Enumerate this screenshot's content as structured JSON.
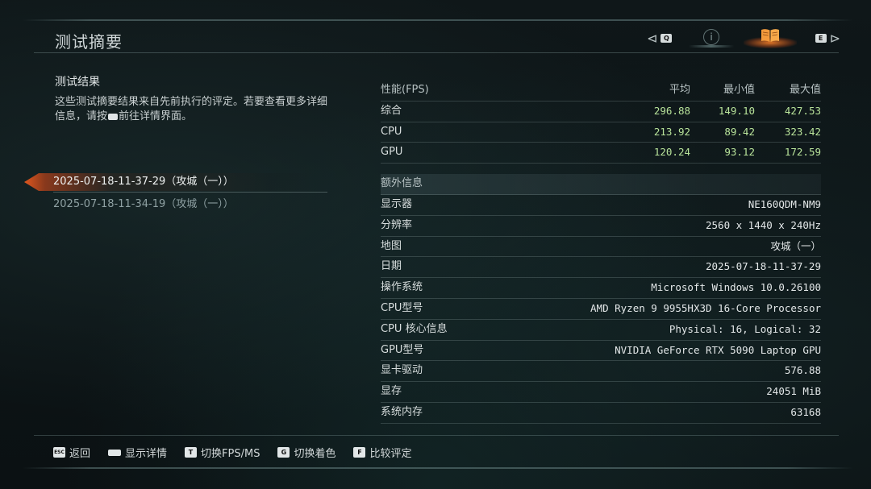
{
  "page": {
    "title": "测试摘要"
  },
  "nav": {
    "prev_key": "Q",
    "next_key": "E",
    "tabs": [
      {
        "name": "info",
        "active": false
      },
      {
        "name": "book",
        "active": true
      }
    ],
    "accent_color": "#ff7a2a"
  },
  "summary": {
    "section_title": "测试结果",
    "description_part1": "这些测试摘要结果来自先前执行的评定。若要查看更多详细信息，请按",
    "description_part2": "前往详情界面。"
  },
  "runs": [
    {
      "label": "2025-07-18-11-37-29（攻城（一））",
      "active": true
    },
    {
      "label": "2025-07-18-11-34-19（攻城（一））",
      "active": false
    }
  ],
  "performance": {
    "header": {
      "label": "性能(FPS)",
      "avg": "平均",
      "min": "最小值",
      "max": "最大值"
    },
    "rows": [
      {
        "label": "综合",
        "avg": "296.88",
        "min": "149.10",
        "max": "427.53"
      },
      {
        "label": "CPU",
        "avg": "213.92",
        "min": "89.42",
        "max": "323.42"
      },
      {
        "label": "GPU",
        "avg": "120.24",
        "min": "93.12",
        "max": "172.59"
      }
    ]
  },
  "extra": {
    "header": "额外信息",
    "rows": [
      {
        "label": "显示器",
        "value": "NE160QDM-NM9"
      },
      {
        "label": "分辨率",
        "value": "2560 x 1440 x 240Hz"
      },
      {
        "label": "地图",
        "value": "攻城（一）"
      },
      {
        "label": "日期",
        "value": "2025-07-18-11-37-29"
      },
      {
        "label": "操作系统",
        "value": "Microsoft Windows 10.0.26100"
      },
      {
        "label": "CPU型号",
        "value": "AMD Ryzen 9 9955HX3D 16-Core Processor"
      },
      {
        "label": "CPU 核心信息",
        "value": "Physical: 16, Logical: 32"
      },
      {
        "label": "GPU型号",
        "value": "NVIDIA GeForce RTX 5090 Laptop GPU"
      },
      {
        "label": "显卡驱动",
        "value": "576.88"
      },
      {
        "label": "显存",
        "value": "24051 MiB"
      },
      {
        "label": "系统内存",
        "value": "63168"
      }
    ]
  },
  "footer": {
    "items": [
      {
        "key": "ESC",
        "label": "返回"
      },
      {
        "key": "",
        "label": "显示详情"
      },
      {
        "key": "T",
        "label": "切换FPS/MS"
      },
      {
        "key": "G",
        "label": "切换着色"
      },
      {
        "key": "F",
        "label": "比较评定"
      }
    ]
  },
  "colors": {
    "value_green": "#b8e39a",
    "active_orange": "#eb5a1e"
  }
}
